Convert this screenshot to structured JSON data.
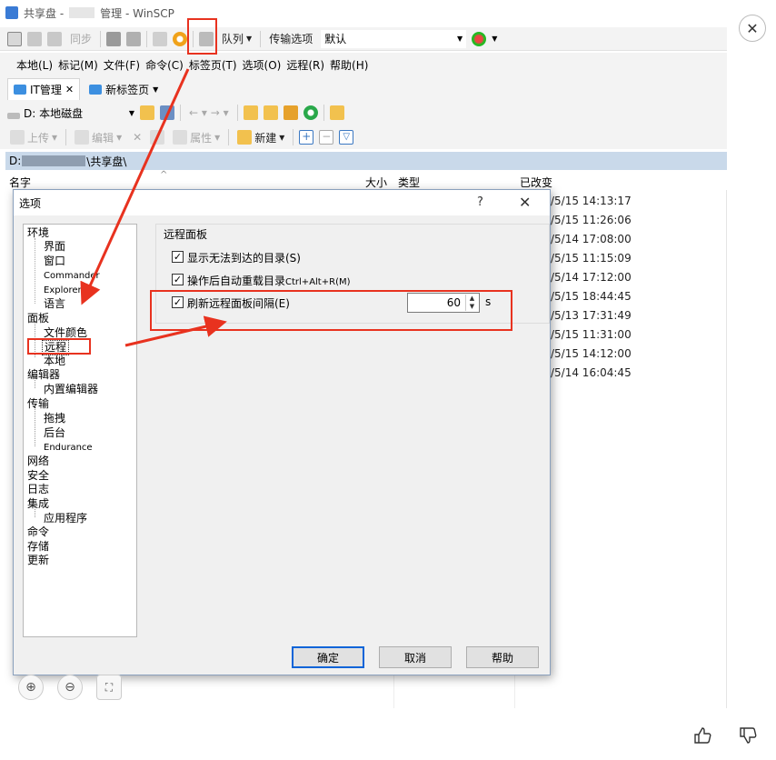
{
  "window": {
    "title_prefix": "共享盘 -",
    "title_suffix": "管理 - WinSCP",
    "close_icon_label": "✕"
  },
  "toolbar1": {
    "sync_label": "同步",
    "queue_label": "队列",
    "transfer_options_label": "传输选项",
    "transfer_value": "默认"
  },
  "menu": [
    "本地(L)",
    "标记(M)",
    "文件(F)",
    "命令(C)",
    "标签页(T)",
    "选项(O)",
    "远程(R)",
    "帮助(H)"
  ],
  "tabs": [
    {
      "label": "IT管理",
      "close": "✕"
    },
    {
      "label": "新标签页"
    }
  ],
  "drive": {
    "label": "D: 本地磁盘"
  },
  "toolbar3": {
    "upload_label": "上传",
    "edit_label": "编辑",
    "properties_label": "属性",
    "new_label": "新建"
  },
  "path": {
    "prefix": "D:",
    "suffix": "\\共享盘\\"
  },
  "columns": {
    "name": "名字",
    "size": "大小",
    "type": "类型",
    "changed": "已改变"
  },
  "file_dates": [
    "/5/15 14:13:17",
    "/5/15 11:26:06",
    "/5/14 17:08:00",
    "/5/15 11:15:09",
    "/5/14 17:12:00",
    "/5/15 18:44:45",
    "/5/13 17:31:49",
    "/5/15 11:31:00",
    "/5/15 14:12:00",
    "/5/14 16:04:45"
  ],
  "dialog": {
    "title": "选项",
    "help_glyph": "?",
    "close_glyph": "✕",
    "tree": {
      "env": "环境",
      "interface": "界面",
      "window": "窗口",
      "commander": "Commander",
      "explorer": "Explorer",
      "language": "语言",
      "panels": "面板",
      "file_colors": "文件颜色",
      "remote": "远程",
      "local": "本地",
      "editors": "编辑器",
      "internal_editor": "内置编辑器",
      "transfer": "传输",
      "drag": "拖拽",
      "background": "后台",
      "endurance": "Endurance",
      "network": "网络",
      "security": "安全",
      "logging": "日志",
      "integration": "集成",
      "applications": "应用程序",
      "commands": "命令",
      "storage": "存储",
      "updates": "更新"
    },
    "group_label": "远程面板",
    "opt1": "显示无法到达的目录(S)",
    "opt2_main": "操作后自动重载目录",
    "opt2_shortcut": "Ctrl+Alt+R",
    "opt2_key": "(M)",
    "opt3": "刷新远程面板间隔(E)",
    "interval_value": "60",
    "interval_unit": "s",
    "ok_label": "确定",
    "cancel_label": "取消",
    "help_label": "帮助"
  },
  "colors": {
    "annotation_red": "#e8321f",
    "path_bar": "#c9d9ea",
    "ok_border": "#0a64d8"
  },
  "icons": [
    "zoom-in-icon",
    "zoom-out-icon",
    "fit-screen-icon",
    "thumbs-up-icon",
    "thumbs-down-icon",
    "gear-icon"
  ]
}
